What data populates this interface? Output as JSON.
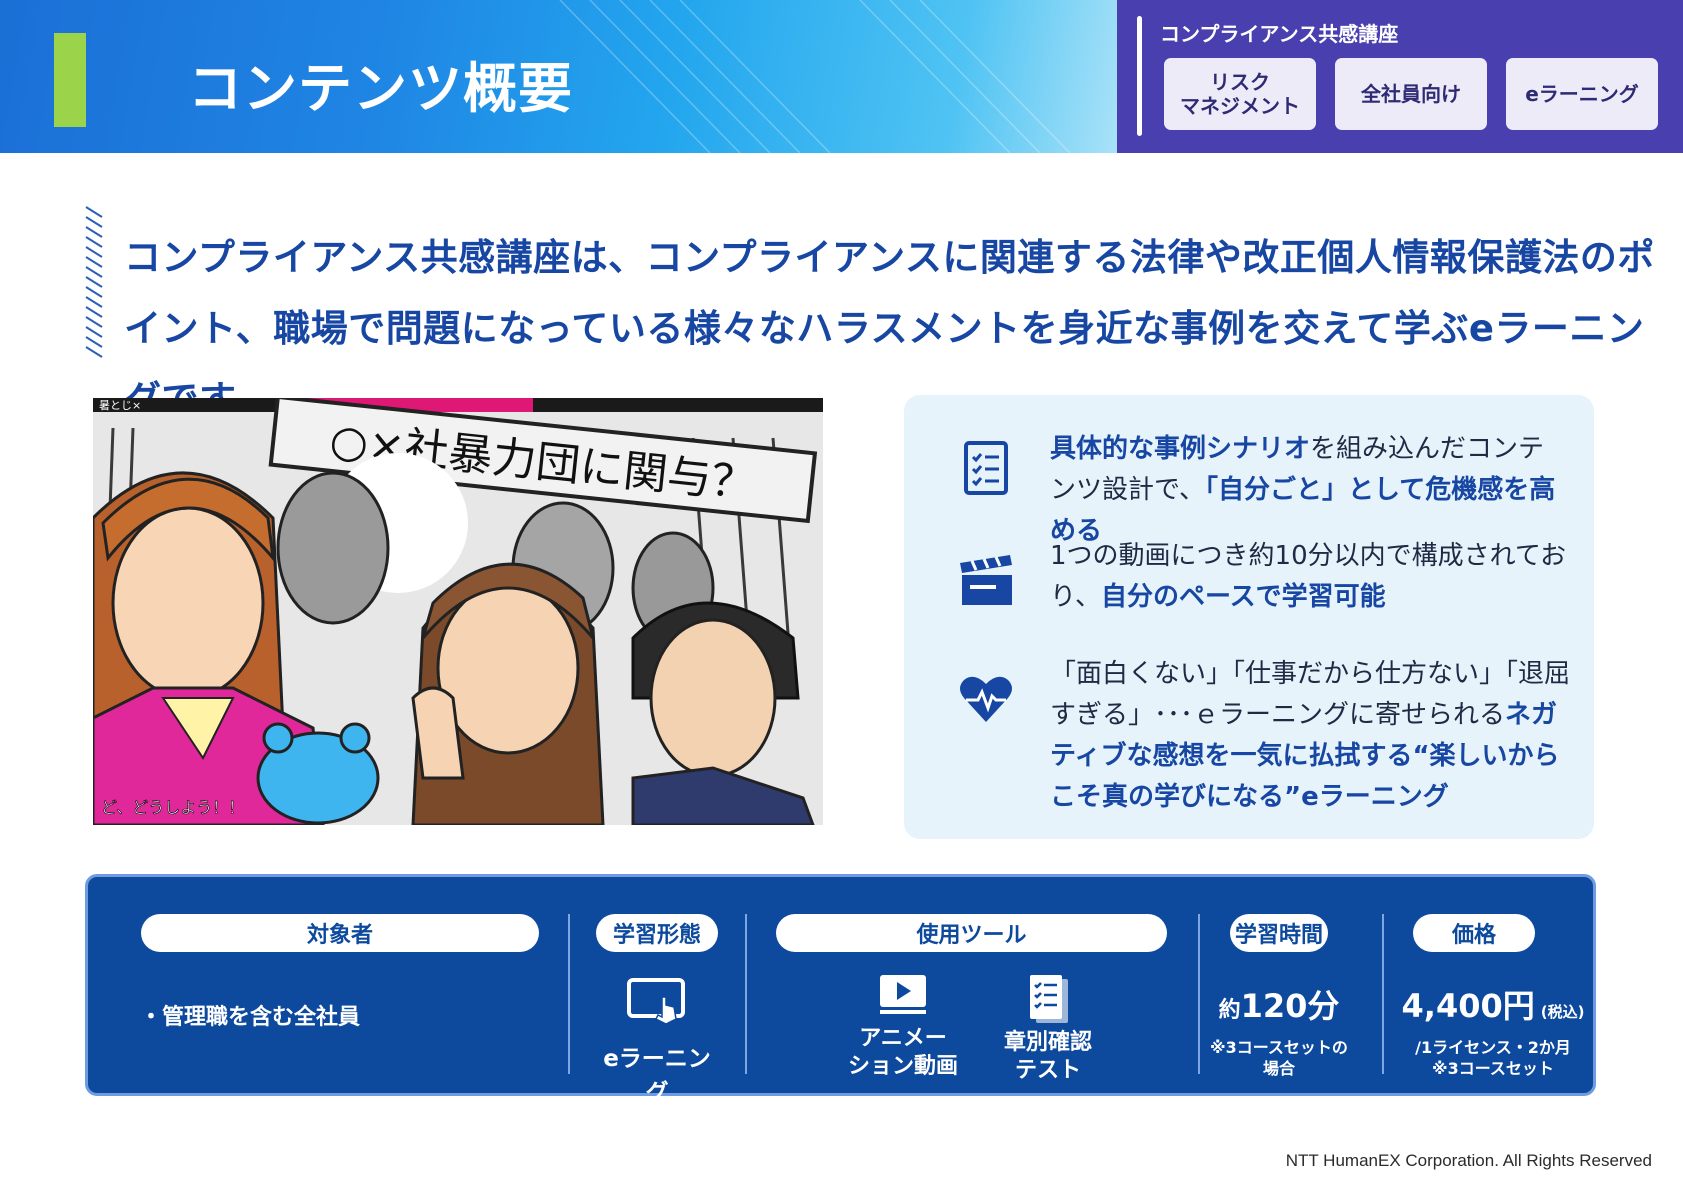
{
  "header": {
    "title": "コンテンツ概要",
    "course_name": "コンプライアンス共感講座",
    "tags": [
      "リスク\nマネジメント",
      "全社員向け",
      "eラーニング"
    ]
  },
  "lead_text": "コンプライアンス共感講座は、コンプライアンスに関連する法律や改正個人情報保護法のポイント、職場で問題になっている様々なハラスメントを身近な事例を交えて学ぶeラーニングです。",
  "illustration": {
    "headline_sign": "○×社暴力団に関与？",
    "caption": "ど、どうしよう！！",
    "top_strip_text": "暑とじ×"
  },
  "features": [
    {
      "icon": "checklist-icon",
      "parts": [
        {
          "text": "具体的な事例シナリオ",
          "hl": true
        },
        {
          "text": "を組み込んだコンテンツ設計で、",
          "hl": false
        },
        {
          "text": "「自分ごと」として危機感を高める",
          "hl": true
        }
      ]
    },
    {
      "icon": "clapperboard-icon",
      "parts": [
        {
          "text": "1つの動画につき約10分以内で構成されており、",
          "hl": false
        },
        {
          "text": "自分のペースで学習可能",
          "hl": true
        }
      ]
    },
    {
      "icon": "heartbeat-icon",
      "parts": [
        {
          "text": "「面白くない」「仕事だから仕方ない」「退屈すぎる」･･･ｅラーニングに寄せられる",
          "hl": false
        },
        {
          "text": "ネガティブな感想を一気に払拭する“楽しいからこそ真の学びになる”eラーニング",
          "hl": true
        }
      ]
    }
  ],
  "info": {
    "target": {
      "label": "対象者",
      "value": "・管理職を含む全社員"
    },
    "format": {
      "label": "学習形態",
      "value": "eラーニング",
      "icon": "tablet-touch-icon"
    },
    "tools": {
      "label": "使用ツール",
      "items": [
        {
          "name": "アニメー\nション動画",
          "icon": "video-icon"
        },
        {
          "name": "章別確認\nテスト",
          "icon": "test-sheet-icon"
        }
      ]
    },
    "time": {
      "label": "学習時間",
      "prefix": "約",
      "value": "120分",
      "note": "※3コースセットの\n場合"
    },
    "price": {
      "label": "価格",
      "value": "4,400円",
      "tax": "(税込)",
      "note": "/1ライセンス・2か月\n※3コースセット"
    }
  },
  "footer": "NTT HumanEX Corporation. All Rights Reserved",
  "colors": {
    "header_purple": "#4a3fae",
    "accent_green": "#9bd34a",
    "info_blue": "#0d4a9e",
    "text_blue": "#1747a3",
    "panel_bg": "#e6f3fb"
  }
}
